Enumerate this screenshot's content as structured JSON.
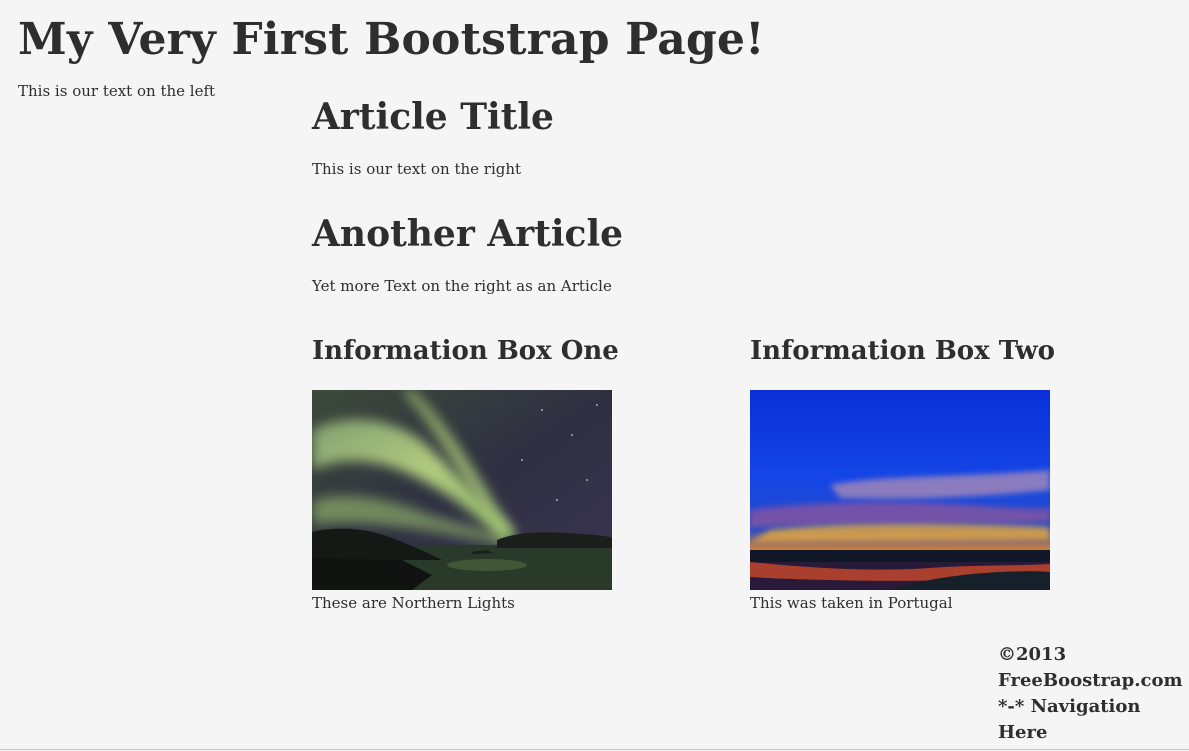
{
  "page": {
    "title": "My Very First Bootstrap Page!",
    "left_text": "This is our text on the left"
  },
  "articles": [
    {
      "title": "Article Title",
      "body": "This is our text on the right"
    },
    {
      "title": "Another Article",
      "body": "Yet more Text on the right as an Article"
    }
  ],
  "info_boxes": [
    {
      "title": "Information Box One",
      "image": "northern-lights-photo",
      "caption": "These are Northern Lights"
    },
    {
      "title": "Information Box Two",
      "image": "sunset-photo",
      "caption": "This was taken in Portugal"
    }
  ],
  "footer": {
    "copyright": "©2013",
    "site": "FreeBoostrap.com",
    "nav": "*-* Navigation",
    "nav2": "Here"
  },
  "colors": {
    "background": "#f5f5f5",
    "text": "#2e2e2e"
  }
}
